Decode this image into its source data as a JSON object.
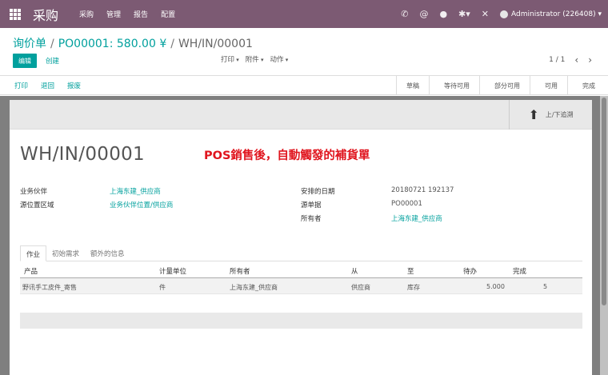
{
  "navbar": {
    "brand": "采购",
    "menu": [
      "采购",
      "管理",
      "报告",
      "配置"
    ],
    "systray": {
      "phone": "✆",
      "at": "@",
      "chat": "●",
      "settings": "✱▾",
      "tools": "✕"
    },
    "user": "Administrator (226408) ▾"
  },
  "breadcrumb": {
    "item1": "询价单",
    "item2": "PO00001: 580.00 ¥",
    "current": "WH/IN/00001",
    "sep": "/"
  },
  "buttons": {
    "edit": "编辑",
    "create": "创建"
  },
  "sidebar": {
    "print": "打印",
    "attachment": "附件",
    "action": "动作"
  },
  "pager": {
    "value": "1 / 1",
    "prev": "‹",
    "next": "›"
  },
  "statusbar": {
    "buttons": [
      "打印",
      "退回",
      "报废"
    ],
    "stages": [
      "草稿",
      "等待可用",
      "部分可用",
      "可用",
      "完成"
    ]
  },
  "smart_button": {
    "label": "上/下追溯",
    "icon": "⬆"
  },
  "record": {
    "title": "WH/IN/00001",
    "annotation": "POS銷售後，自動觸發的補貨單"
  },
  "fields_left": [
    {
      "label": "业务伙伴",
      "value": "上海东建_供应商"
    },
    {
      "label": "源位置区域",
      "value": "业务伙伴位置/供应商"
    }
  ],
  "fields_right": [
    {
      "label": "安排的日期",
      "value": "20180721 192137"
    },
    {
      "label": "源单据",
      "value": "PO00001"
    },
    {
      "label": "所有者",
      "value": "上海东建_供应商"
    }
  ],
  "tabs": [
    "作业",
    "初始需求",
    "额外的信息"
  ],
  "table": {
    "headers": [
      "产品",
      "计量单位",
      "所有者",
      "从",
      "至",
      "待办",
      "完成"
    ],
    "rows": [
      [
        "野讯手工皮件_寄售",
        "件",
        "上海东建_供应商",
        "供应商",
        "库存",
        "5.000",
        "5"
      ]
    ]
  },
  "colors": {
    "navbar": "#7c5a73",
    "accent": "#00a09d",
    "annotation": "#e0151e"
  }
}
